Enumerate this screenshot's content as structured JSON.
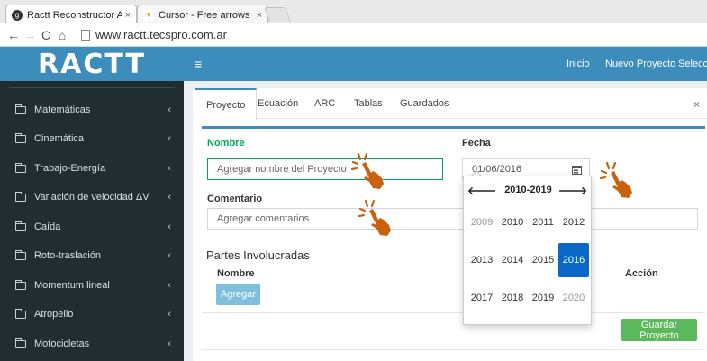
{
  "browser": {
    "tabs": [
      {
        "label": "Ractt Reconstructor Analí",
        "close": "×"
      },
      {
        "label": "Cursor - Free arrows icons",
        "close": "×"
      }
    ],
    "url": "www.ractt.tecspro.com.ar"
  },
  "header": {
    "logo": "RACTT",
    "nav": [
      "Inicio",
      "Nuevo Proyecto",
      "Seleccio"
    ]
  },
  "sidebar": {
    "items": [
      {
        "label": "Matemáticas"
      },
      {
        "label": "Cinemática"
      },
      {
        "label": "Trabajo-Energía"
      },
      {
        "label": "Variación de velocidad ΔV"
      },
      {
        "label": "Caída"
      },
      {
        "label": "Roto-traslación"
      },
      {
        "label": "Momentum lineal"
      },
      {
        "label": "Atropello"
      },
      {
        "label": "Motocicletas"
      }
    ]
  },
  "main": {
    "tabs": [
      "Proyecto",
      "Ecuación",
      "ARC",
      "Tablas",
      "Guardados"
    ],
    "close": "×",
    "form": {
      "nombre_label": "Nombre",
      "nombre_placeholder": "Agregar nombre del Proyecto",
      "fecha_label": "Fecha",
      "fecha_value": "01/06/2016",
      "comentario_label": "Comentario",
      "comentario_placeholder": "Agregar comentarios"
    },
    "partes": {
      "title": "Partes Involucradas",
      "col_nombre": "Nombre",
      "col_accion": "Acción",
      "add_button": "Agregar"
    },
    "save_button": "Guardar Proyecto"
  },
  "datepicker": {
    "prev": "🡐",
    "next": "🡒",
    "title": "2010-2019",
    "years": [
      "2009",
      "2010",
      "2011",
      "2012",
      "2013",
      "2014",
      "2015",
      "2016",
      "2017",
      "2018",
      "2019",
      "2020"
    ],
    "selected": "2016"
  },
  "colors": {
    "brand": "#3c8dbc",
    "sidebar": "#222d32",
    "success": "#00a65a",
    "selected_year": "#0a68c9",
    "cursor": "#c8620f"
  },
  "icons": {
    "calendar": "calendar-icon",
    "cursor": "hand-pointer-icon"
  }
}
